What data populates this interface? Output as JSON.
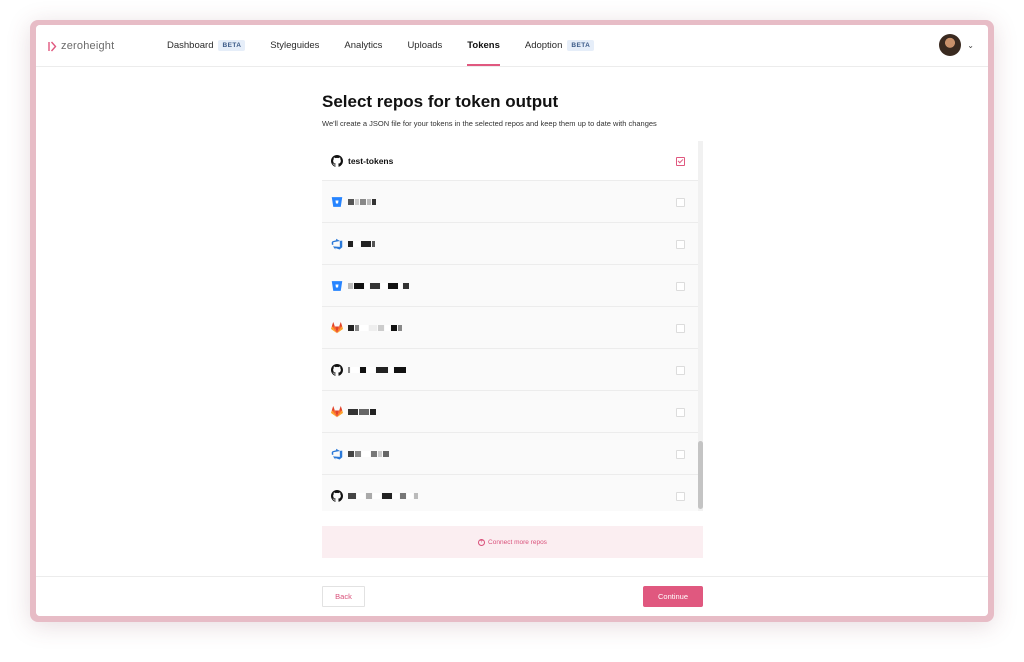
{
  "app": {
    "logo_text": "zeroheight"
  },
  "nav": {
    "items": [
      {
        "label": "Dashboard",
        "badge": "BETA"
      },
      {
        "label": "Styleguides"
      },
      {
        "label": "Analytics"
      },
      {
        "label": "Uploads"
      },
      {
        "label": "Tokens",
        "active": true
      },
      {
        "label": "Adoption",
        "badge": "BETA"
      }
    ]
  },
  "page": {
    "title": "Select repos for token output",
    "subtitle": "We'll create a JSON file for your tokens in the selected repos and keep them up to date with changes"
  },
  "repos": [
    {
      "provider": "github-icon",
      "name": "test-tokens",
      "checked": true
    },
    {
      "provider": "bitbucket-icon",
      "name": "",
      "checked": false
    },
    {
      "provider": "azure-devops-icon",
      "name": "",
      "checked": false
    },
    {
      "provider": "bitbucket-icon",
      "name": "",
      "checked": false
    },
    {
      "provider": "gitlab-icon",
      "name": "",
      "checked": false
    },
    {
      "provider": "github-icon",
      "name": "",
      "checked": false
    },
    {
      "provider": "gitlab-icon",
      "name": "",
      "checked": false
    },
    {
      "provider": "azure-devops-icon",
      "name": "",
      "checked": false
    },
    {
      "provider": "github-icon",
      "name": "",
      "checked": false
    }
  ],
  "connect": {
    "label": "Connect more repos"
  },
  "footer": {
    "back_label": "Back",
    "continue_label": "Continue"
  },
  "colors": {
    "accent": "#e0587f",
    "frame": "#e7bcc6"
  }
}
